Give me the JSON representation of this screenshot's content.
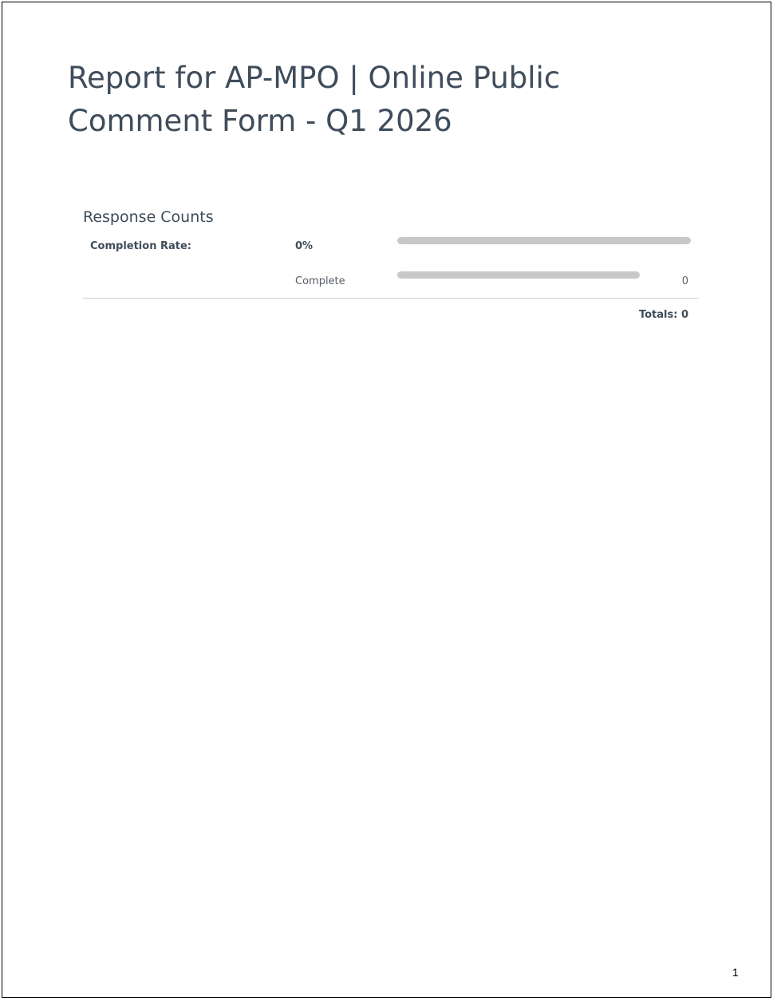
{
  "report": {
    "title": "Report for AP-MPO | Online Public Comment Form - Q1 2026"
  },
  "response_counts": {
    "section_title": "Response Counts",
    "completion_rate_label": "Completion Rate:",
    "completion_rate_value": "0%",
    "completion_rate_fraction": 0,
    "complete_label": "Complete",
    "complete_count": "0",
    "complete_fraction": 0,
    "totals": "Totals: 0"
  },
  "footer": {
    "page_number": "1"
  },
  "colors": {
    "heading_text": "#3f4c5a",
    "bar_track": "#c8c8c8",
    "divider": "#d0d0d0"
  }
}
